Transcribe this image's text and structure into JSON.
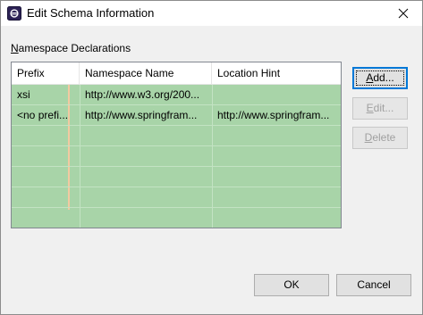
{
  "window": {
    "title": "Edit Schema Information",
    "icon": "eclipse-icon",
    "close_glyph": "✕"
  },
  "section": {
    "label_mnemonic": "N",
    "label_rest": "amespace Declarations"
  },
  "table": {
    "columns": [
      "Prefix",
      "Namespace Name",
      "Location Hint"
    ],
    "rows": [
      {
        "prefix": "xsi",
        "namespace": "http://www.w3.org/200...",
        "location": ""
      },
      {
        "prefix": "<no prefi...",
        "namespace": "http://www.springfram...",
        "location": "http://www.springfram..."
      }
    ],
    "row_color": "#a8d4a8"
  },
  "buttons": {
    "add": {
      "mnemonic": "A",
      "rest": "dd...",
      "enabled": true
    },
    "edit": {
      "mnemonic": "E",
      "rest": "dit...",
      "enabled": false
    },
    "delete": {
      "mnemonic": "D",
      "rest": "elete",
      "enabled": false
    },
    "ok": {
      "label": "OK"
    },
    "cancel": {
      "label": "Cancel"
    }
  },
  "colors": {
    "accent": "#0078d7",
    "selection": "#a8d4a8"
  }
}
